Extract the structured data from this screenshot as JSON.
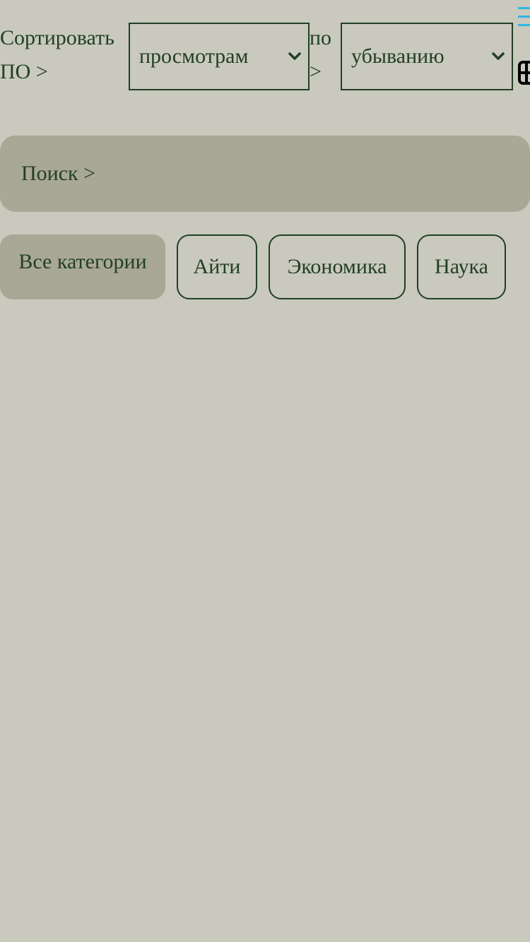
{
  "sort": {
    "label": "Сортировать ПО >",
    "by_value": "просмотрам",
    "order_label": "по >",
    "order_value": "убыванию"
  },
  "search": {
    "label": "Поиск >"
  },
  "categories": [
    {
      "label": "Все категории",
      "active": true
    },
    {
      "label": "Айти",
      "active": false
    },
    {
      "label": "Экономика",
      "active": false
    },
    {
      "label": "Наука",
      "active": false
    }
  ],
  "icons": {
    "menu": "menu-icon",
    "grid": "grid-view-icon",
    "chevron": "chevron-down-icon"
  },
  "colors": {
    "background": "#c9c9bd",
    "text": "#213f27",
    "panel": "#a9a796",
    "menu_icon": "#2fb7e3"
  }
}
